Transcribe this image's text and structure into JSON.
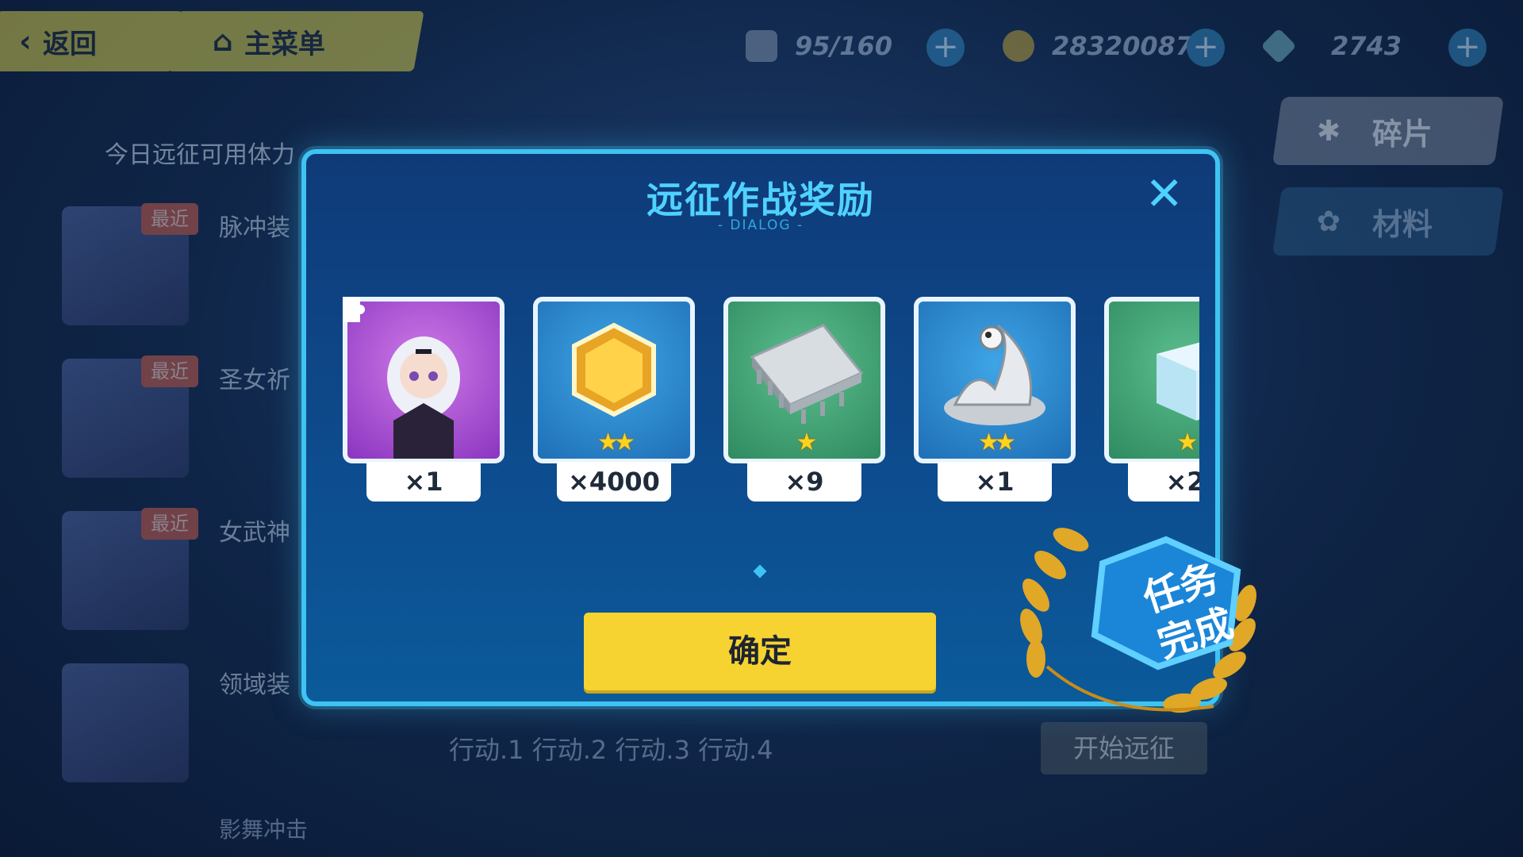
{
  "header": {
    "back_label": "返回",
    "main_menu_label": "主菜单",
    "stamina": "95/160",
    "coins": "28320087",
    "crystals": "2743"
  },
  "side_tabs": [
    {
      "label": "碎片"
    },
    {
      "label": "材料"
    }
  ],
  "background": {
    "stamina_title": "今日远征可用体力",
    "list": [
      {
        "tag": "最近",
        "label": "脉冲装"
      },
      {
        "tag": "最近",
        "label": "圣女祈"
      },
      {
        "tag": "最近",
        "label": "女武神"
      },
      {
        "tag": "",
        "label": "领域装"
      }
    ],
    "actions_label": "行动.1 行动.2 行动.3 行动.4",
    "start_label": "开始远征",
    "bottom_label": "影舞冲击"
  },
  "dialog": {
    "title": "远征作战奖励",
    "subtitle": "- DIALOG -",
    "confirm_label": "确定",
    "rewards": [
      {
        "name": "character-fragment",
        "qty": "×1",
        "stars": "",
        "color": "#a94fd6"
      },
      {
        "name": "gold-coin",
        "qty": "×4000",
        "stars": "★★",
        "color": "#2d86c9"
      },
      {
        "name": "chip",
        "qty": "×9",
        "stars": "★",
        "color": "#3f9a6e"
      },
      {
        "name": "liquid-metal",
        "qty": "×1",
        "stars": "★★",
        "color": "#2d86c9"
      },
      {
        "name": "ice-cube",
        "qty": "×2",
        "stars": "★",
        "color": "#3f9a6e"
      }
    ]
  },
  "badge": {
    "line1": "任务",
    "line2": "完成"
  }
}
